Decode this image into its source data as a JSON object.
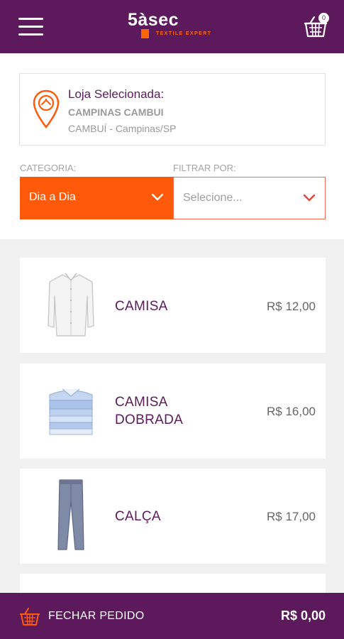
{
  "header": {
    "brand": "5àsec",
    "brand_tagline": "TEXTILE EXPERT",
    "cart_count": "0",
    "icons": {
      "menu": "hamburger-menu-icon",
      "cart": "basket-icon"
    }
  },
  "store": {
    "title": "Loja Selecionada:",
    "name": "CAMPINAS CAMBUI",
    "location": "CAMBUÍ - Campinas/SP",
    "icon": "store-location-pin-icon"
  },
  "filters": {
    "category_label": "CATEGORIA:",
    "category_value": "Dia a Dia",
    "filter_label": "FILTRAR POR:",
    "filter_placeholder": "Selecione..."
  },
  "products": [
    {
      "name_line1": "CAMISA",
      "name_line2": "",
      "price": "R$ 12,00",
      "image": "white-shirt"
    },
    {
      "name_line1": "CAMISA",
      "name_line2": "DOBRADA",
      "price": "R$ 16,00",
      "image": "folded-shirts"
    },
    {
      "name_line1": "CALÇA",
      "name_line2": "",
      "price": "R$ 17,00",
      "image": "trousers"
    }
  ],
  "footer": {
    "label": "FECHAR PEDIDO",
    "total": "R$ 0,00",
    "icon": "basket-icon"
  },
  "colors": {
    "primary": "#5c1a5c",
    "accent": "#ff5a0a",
    "brand_orange": "#ff6600",
    "background": "#f1f1f1"
  }
}
